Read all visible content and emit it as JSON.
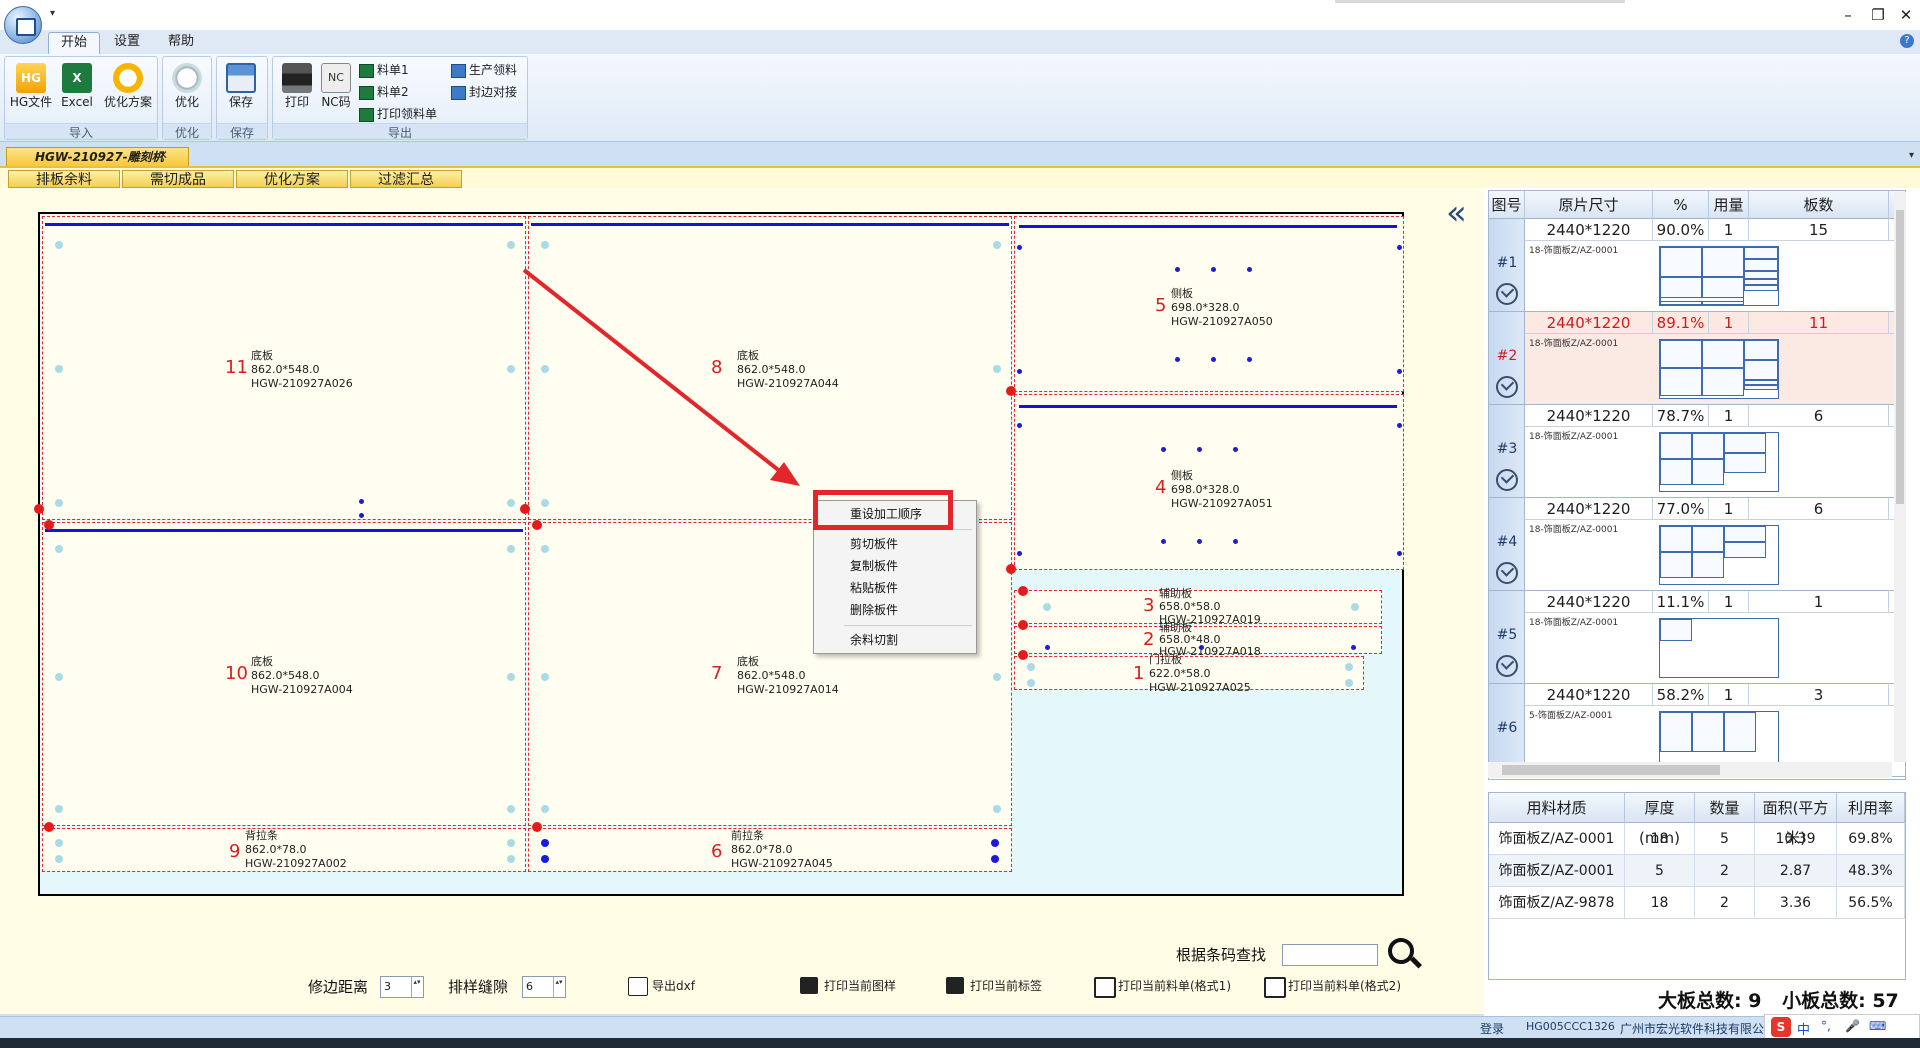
{
  "menu": {
    "tabs": [
      "开始",
      "设置",
      "帮助"
    ],
    "active": 0
  },
  "ribbon": {
    "import_group": {
      "label": "导入",
      "hg": "HG文件",
      "excel": "Excel",
      "plan": "优化方案"
    },
    "optimize_group": {
      "label": "优化",
      "btn": "优化"
    },
    "save_group": {
      "label": "保存",
      "btn": "保存"
    },
    "export_group": {
      "label": "导出",
      "print": "打印",
      "nc": "NC码",
      "nc_icon": "NC",
      "list1": "料单1",
      "list2": "料单2",
      "print_picking": "打印领料单",
      "production": "生产领料",
      "edge": "封边对接"
    },
    "hg_icon": "HG",
    "excel_icon": "X"
  },
  "doc_tab": {
    "label": "HGW-210927-雕刻机"
  },
  "subtabs": [
    "排板余料",
    "需切成品",
    "优化方案",
    "过滤汇总"
  ],
  "parts": [
    {
      "num": "11",
      "name": "底板",
      "size": "862.0*548.0",
      "code": "HGW-210927A026"
    },
    {
      "num": "8",
      "name": "底板",
      "size": "862.0*548.0",
      "code": "HGW-210927A044"
    },
    {
      "num": "5",
      "name": "侧板",
      "size": "698.0*328.0",
      "code": "HGW-210927A050"
    },
    {
      "num": "4",
      "name": "侧板",
      "size": "698.0*328.0",
      "code": "HGW-210927A051"
    },
    {
      "num": "10",
      "name": "底板",
      "size": "862.0*548.0",
      "code": "HGW-210927A004"
    },
    {
      "num": "7",
      "name": "底板",
      "size": "862.0*548.0",
      "code": "HGW-210927A014"
    },
    {
      "num": "3",
      "name": "辅助板",
      "size": "658.0*58.0",
      "code": "HGW-210927A019"
    },
    {
      "num": "2",
      "name": "辅助板",
      "size": "658.0*48.0",
      "code": "HGW-210927A018"
    },
    {
      "num": "1",
      "name": "门拉板",
      "size": "622.0*58.0",
      "code": "HGW-210927A025"
    },
    {
      "num": "9",
      "name": "背拉条",
      "size": "862.0*78.0",
      "code": "HGW-210927A002"
    },
    {
      "num": "6",
      "name": "前拉条",
      "size": "862.0*78.0",
      "code": "HGW-210927A045"
    }
  ],
  "context_menu": [
    "重设加工顺序",
    "剪切板件",
    "复制板件",
    "粘贴板件",
    "删除板件",
    "余料切割"
  ],
  "bottom": {
    "trim_label": "修边距离",
    "trim_value": "3",
    "gap_label": "排样缝隙",
    "gap_value": "6",
    "export_dxf": "导出dxf",
    "print_drawing": "打印当前图样",
    "print_label": "打印当前标签",
    "print_list1": "打印当前料单(格式1)",
    "print_list2": "打印当前料单(格式2)",
    "barcode_label": "根据条码查找",
    "barcode_value": ""
  },
  "sheets_table": {
    "headers": [
      "图号",
      "原片尺寸",
      "%",
      "用量",
      "板数"
    ],
    "rows": [
      {
        "id": "#1",
        "size": "2440*1220",
        "pct": "90.0%",
        "qty": "1",
        "count": "15",
        "mat": "18-饰面板Z/AZ-0001"
      },
      {
        "id": "#2",
        "size": "2440*1220",
        "pct": "89.1%",
        "qty": "1",
        "count": "11",
        "mat": "18-饰面板Z/AZ-0001"
      },
      {
        "id": "#3",
        "size": "2440*1220",
        "pct": "78.7%",
        "qty": "1",
        "count": "6",
        "mat": "18-饰面板Z/AZ-0001"
      },
      {
        "id": "#4",
        "size": "2440*1220",
        "pct": "77.0%",
        "qty": "1",
        "count": "6",
        "mat": "18-饰面板Z/AZ-0001"
      },
      {
        "id": "#5",
        "size": "2440*1220",
        "pct": "11.1%",
        "qty": "1",
        "count": "1",
        "mat": "18-饰面板Z/AZ-0001"
      },
      {
        "id": "#6",
        "size": "2440*1220",
        "pct": "58.2%",
        "qty": "1",
        "count": "3",
        "mat": "5-饰面板Z/AZ-0001"
      }
    ]
  },
  "material_table": {
    "headers": [
      "用料材质",
      "厚度(mm)",
      "数量",
      "面积(平方米)",
      "利用率"
    ],
    "rows": [
      [
        "饰面板Z/AZ-0001",
        "18",
        "5",
        "10.39",
        "69.8%"
      ],
      [
        "饰面板Z/AZ-0001",
        "5",
        "2",
        "2.87",
        "48.3%"
      ],
      [
        "饰面板Z/AZ-9878",
        "18",
        "2",
        "3.36",
        "56.5%"
      ]
    ]
  },
  "totals": {
    "big_label": "大板总数:",
    "big_value": "9",
    "small_label": "小板总数:",
    "small_value": "57"
  },
  "status": {
    "login": "登录",
    "code": "HG005CCC1326",
    "company": "广州市宏光软件科技有限公司"
  },
  "ime": {
    "logo": "S",
    "lang": "中"
  }
}
